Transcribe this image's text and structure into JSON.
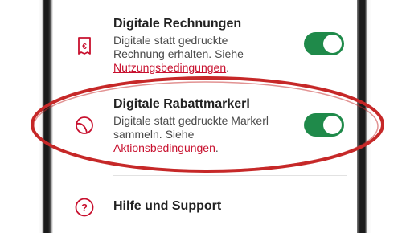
{
  "settings": {
    "items": [
      {
        "title": "Digitale Rechnungen",
        "desc_line1": "Digitale statt gedruckte",
        "desc_line2": "Rechnung erhalten. Siehe",
        "link": "Nutzungsbedingungen",
        "link_suffix": ".",
        "icon": "euro-receipt-icon",
        "toggle_on": true
      },
      {
        "title": "Digitale Rabattmarkerl",
        "desc_line1": "Digitale statt gedruckte Markerl",
        "desc_line2": "sammeln. Siehe",
        "link": "Aktionsbedingungen",
        "link_suffix": ".",
        "icon": "sticker-icon",
        "toggle_on": true
      },
      {
        "title": "Hilfe und Support",
        "icon": "help-icon"
      }
    ]
  },
  "colors": {
    "accent": "#c8102e",
    "toggle_on": "#1f8a4a",
    "highlight_ellipse": "#c62828"
  }
}
